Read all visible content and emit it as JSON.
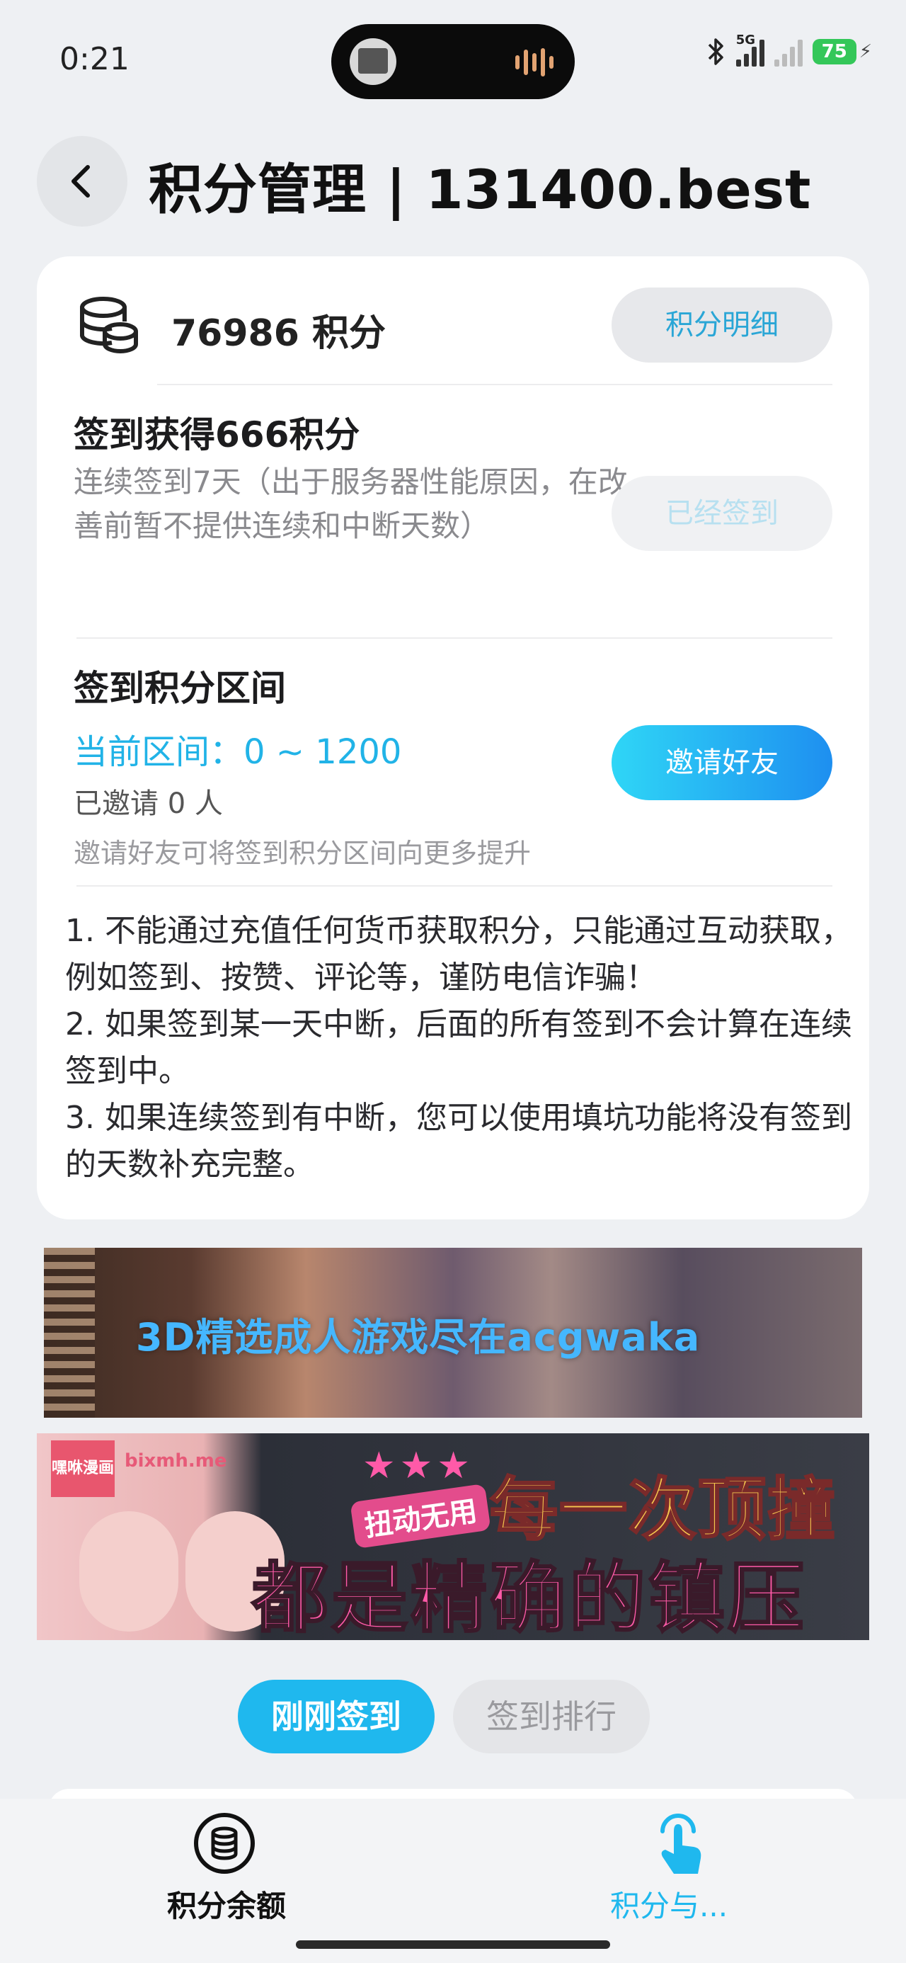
{
  "status_bar": {
    "time": "0:21",
    "network": "5G",
    "battery": "75"
  },
  "header": {
    "title": "积分管理 | 131400.best"
  },
  "points": {
    "balance": "76986 积分",
    "details_button": "积分明细"
  },
  "checkin": {
    "title": "签到获得666积分",
    "description": "连续签到7天（出于服务器性能原因，在改善前暂不提供连续和中断天数）",
    "button": "已经签到"
  },
  "range": {
    "title": "签到积分区间",
    "current": "当前区间：0 ~ 1200",
    "invited": "已邀请 0 人",
    "hint": "邀请好友可将签到积分区间向更多提升",
    "button": "邀请好友"
  },
  "rules": [
    "1. 不能通过充值任何货币获取积分，只能通过互动获取，例如签到、按赞、评论等，谨防电信诈骗！",
    "2. 如果签到某一天中断，后面的所有签到不会计算在连续签到中。",
    "3. 如果连续签到有中断，您可以使用填坑功能将没有签到的天数补充完整。"
  ],
  "ads": {
    "banner1_text": "3D精选成人游戏尽在acgwaka",
    "banner2_logo": "嘿咻漫画",
    "banner2_site": "bixmh.me",
    "banner2_badge": "扭动无用",
    "banner2_line1": "每一次顶撞",
    "banner2_line2": "都是精确的镇压"
  },
  "tabs": {
    "active": "刚刚签到",
    "other": "签到排行"
  },
  "bottom_nav": {
    "left_label": "积分余额",
    "right_label": "积分与..."
  },
  "colors": {
    "accent": "#1fb8ee",
    "accent_text": "#2aa6d6",
    "battery": "#34c759"
  },
  "icons": [
    "chevron-left-icon",
    "coin-stack-icon",
    "coins-circle-icon",
    "tap-hand-icon",
    "bluetooth-icon",
    "signal-icon",
    "battery-icon"
  ]
}
